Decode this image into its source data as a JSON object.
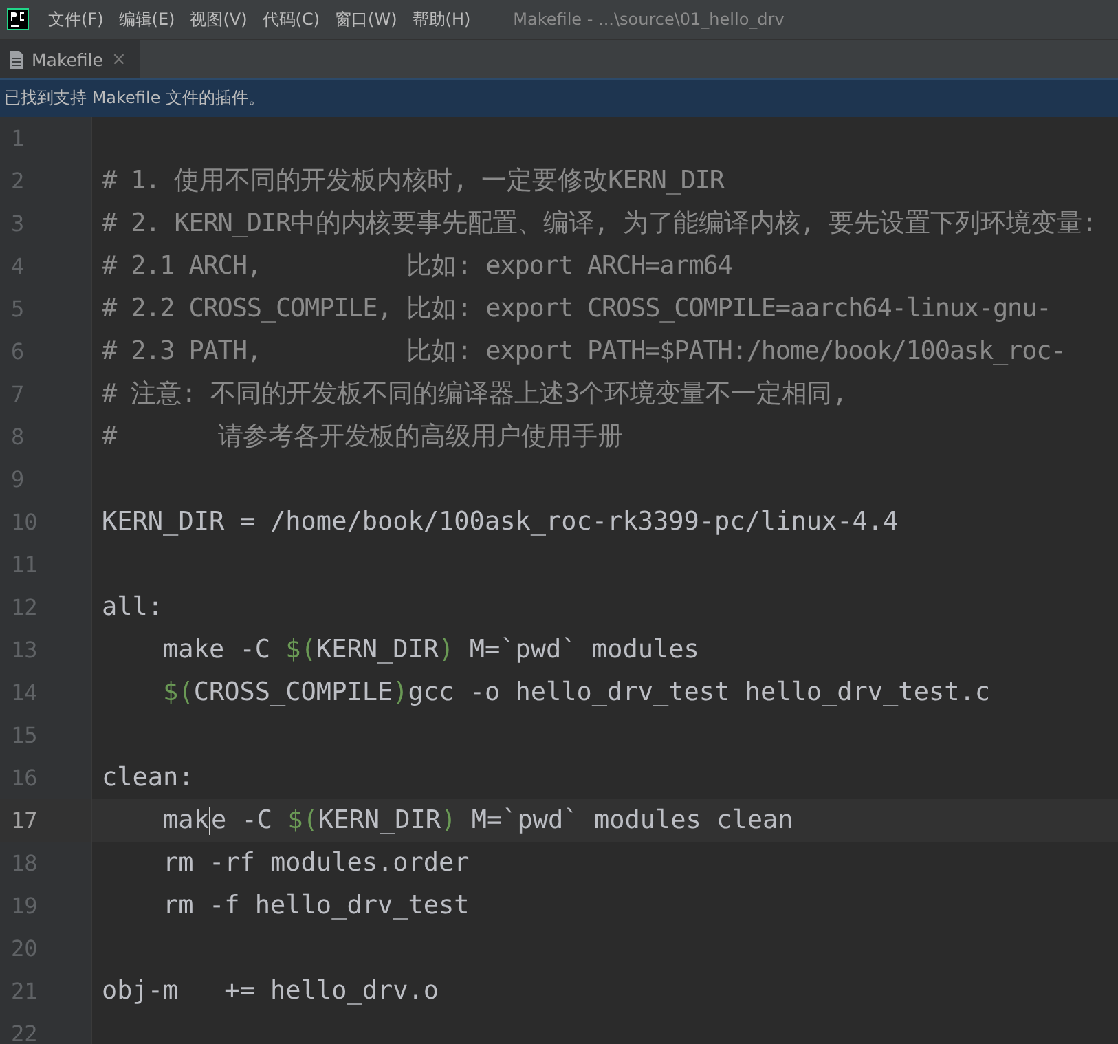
{
  "menu_bar": {
    "items": [
      "文件(F)",
      "编辑(E)",
      "视图(V)",
      "代码(C)",
      "窗口(W)",
      "帮助(H)"
    ],
    "title": "Makefile - ...\\source\\01_hello_drv"
  },
  "tabs": [
    {
      "label": "Makefile",
      "selected": true,
      "close": "×"
    }
  ],
  "banner": {
    "text": "已找到支持 Makefile 文件的插件。"
  },
  "editor": {
    "lines": [
      {
        "number": "1",
        "current": false
      },
      {
        "number": "2",
        "current": false,
        "segments": [
          {
            "kind": "comment",
            "text": "# 1. 使用不同的开发板内核时, 一定要修改KERN_DIR"
          }
        ]
      },
      {
        "number": "3",
        "current": false,
        "segments": [
          {
            "kind": "comment",
            "text": "# 2. KERN_DIR中的内核要事先配置、编译, 为了能编译内核, 要先设置下列环境变量:"
          }
        ]
      },
      {
        "number": "4",
        "current": false,
        "segments": [
          {
            "kind": "comment",
            "text": "# 2.1 ARCH,          比如: export ARCH=arm64"
          }
        ]
      },
      {
        "number": "5",
        "current": false,
        "segments": [
          {
            "kind": "comment",
            "text": "# 2.2 CROSS_COMPILE, 比如: export CROSS_COMPILE=aarch64-linux-gnu-"
          }
        ]
      },
      {
        "number": "6",
        "current": false,
        "segments": [
          {
            "kind": "comment",
            "text": "# 2.3 PATH,          比如: export PATH=$PATH:/home/book/100ask_roc-"
          }
        ]
      },
      {
        "number": "7",
        "current": false,
        "segments": [
          {
            "kind": "comment",
            "text": "# 注意: 不同的开发板不同的编译器上述3个环境变量不一定相同,"
          }
        ]
      },
      {
        "number": "8",
        "current": false,
        "segments": [
          {
            "kind": "comment",
            "text": "#       请参考各开发板的高级用户使用手册"
          }
        ]
      },
      {
        "number": "9",
        "current": false
      },
      {
        "number": "10",
        "current": false,
        "segments": [
          {
            "kind": "plain",
            "text": "KERN_DIR = /home/book/100ask_roc-rk3399-pc/linux-4.4"
          }
        ]
      },
      {
        "number": "11",
        "current": false
      },
      {
        "number": "12",
        "current": false,
        "segments": [
          {
            "kind": "plain",
            "text": "all:"
          }
        ]
      },
      {
        "number": "13",
        "current": false,
        "indented": true,
        "segments": [
          {
            "kind": "plain",
            "text": "make -C "
          },
          {
            "kind": "macro",
            "text": "$("
          },
          {
            "kind": "plain",
            "text": "KERN_DIR"
          },
          {
            "kind": "macro",
            "text": ")"
          },
          {
            "kind": "plain",
            "text": " M=`pwd` modules"
          }
        ]
      },
      {
        "number": "14",
        "current": false,
        "indented": true,
        "segments": [
          {
            "kind": "macro",
            "text": "$("
          },
          {
            "kind": "plain",
            "text": "CROSS_COMPILE"
          },
          {
            "kind": "macro",
            "text": ")"
          },
          {
            "kind": "plain",
            "text": "gcc -o hello_drv_test hello_drv_test.c"
          }
        ]
      },
      {
        "number": "15",
        "current": false
      },
      {
        "number": "16",
        "current": false,
        "segments": [
          {
            "kind": "plain",
            "text": "clean:"
          }
        ]
      },
      {
        "number": "17",
        "current": true,
        "indented": true,
        "segments": [
          {
            "kind": "plain",
            "text": "mak"
          },
          {
            "kind": "caret"
          },
          {
            "kind": "plain",
            "text": "e -C "
          },
          {
            "kind": "macro",
            "text": "$("
          },
          {
            "kind": "plain",
            "text": "KERN_DIR"
          },
          {
            "kind": "macro",
            "text": ")"
          },
          {
            "kind": "plain",
            "text": " M=`pwd` modules clean"
          }
        ]
      },
      {
        "number": "18",
        "current": false,
        "indented": true,
        "segments": [
          {
            "kind": "plain",
            "text": "rm -rf modules.order"
          }
        ]
      },
      {
        "number": "19",
        "current": false,
        "indented": true,
        "segments": [
          {
            "kind": "plain",
            "text": "rm -f hello_drv_test"
          }
        ]
      },
      {
        "number": "20",
        "current": false
      },
      {
        "number": "21",
        "current": false,
        "segments": [
          {
            "kind": "plain",
            "text": "obj-m   += hello_drv.o"
          }
        ]
      },
      {
        "number": "22",
        "current": false
      }
    ]
  }
}
